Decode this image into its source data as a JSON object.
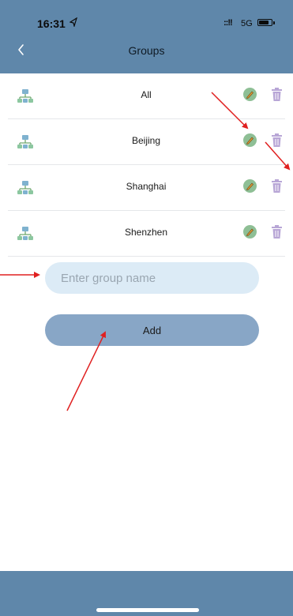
{
  "status_bar": {
    "time": "16:31",
    "location_icon": "location-arrow-icon",
    "signal": "::!!",
    "network": "5G",
    "battery_icon": "battery-icon"
  },
  "header": {
    "back_icon": "chevron-left-icon",
    "title": "Groups"
  },
  "groups": [
    {
      "name": "All",
      "icon": "network-icon"
    },
    {
      "name": "Beijing",
      "icon": "network-icon"
    },
    {
      "name": "Shanghai",
      "icon": "network-icon"
    },
    {
      "name": "Shenzhen",
      "icon": "network-icon"
    }
  ],
  "row_actions": {
    "edit_icon": "edit-icon",
    "delete_icon": "trash-icon"
  },
  "form": {
    "input_placeholder": "Enter group name",
    "input_value": "",
    "add_label": "Add"
  },
  "colors": {
    "header_bg": "#5f87aa",
    "input_bg": "#dcebf6",
    "button_bg": "#88a6c6",
    "edit_icon": "#8ebf95",
    "trash_icon": "#b8a6d6",
    "annotation": "#e02020"
  }
}
